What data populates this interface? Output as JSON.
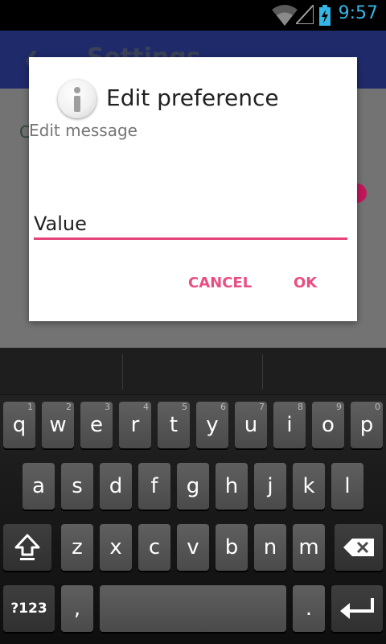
{
  "status_bar": {
    "time": "9:57",
    "icons": [
      "wifi-icon",
      "signal-icon",
      "battery-charging-icon"
    ]
  },
  "activity": {
    "title": "Settings",
    "first_row_initial": "C"
  },
  "dialog": {
    "icon": "info-icon",
    "title": "Edit preference",
    "message": "Edit message",
    "input_value": "Value",
    "cancel_label": "CANCEL",
    "ok_label": "OK",
    "accent_color": "#e5437a"
  },
  "keyboard": {
    "row1": [
      {
        "label": "q",
        "hint": "1"
      },
      {
        "label": "w",
        "hint": "2"
      },
      {
        "label": "e",
        "hint": "3"
      },
      {
        "label": "r",
        "hint": "4"
      },
      {
        "label": "t",
        "hint": "5"
      },
      {
        "label": "y",
        "hint": "6"
      },
      {
        "label": "u",
        "hint": "7"
      },
      {
        "label": "i",
        "hint": "8"
      },
      {
        "label": "o",
        "hint": "9"
      },
      {
        "label": "p",
        "hint": "0"
      }
    ],
    "row2": [
      "a",
      "s",
      "d",
      "f",
      "g",
      "h",
      "j",
      "k",
      "l"
    ],
    "row3": [
      "z",
      "x",
      "c",
      "v",
      "b",
      "n",
      "m"
    ],
    "symbols_label": "?123",
    "comma_label": ",",
    "period_label": ".",
    "shift_icon": "shift-icon",
    "delete_icon": "backspace-icon",
    "enter_icon": "enter-icon"
  }
}
